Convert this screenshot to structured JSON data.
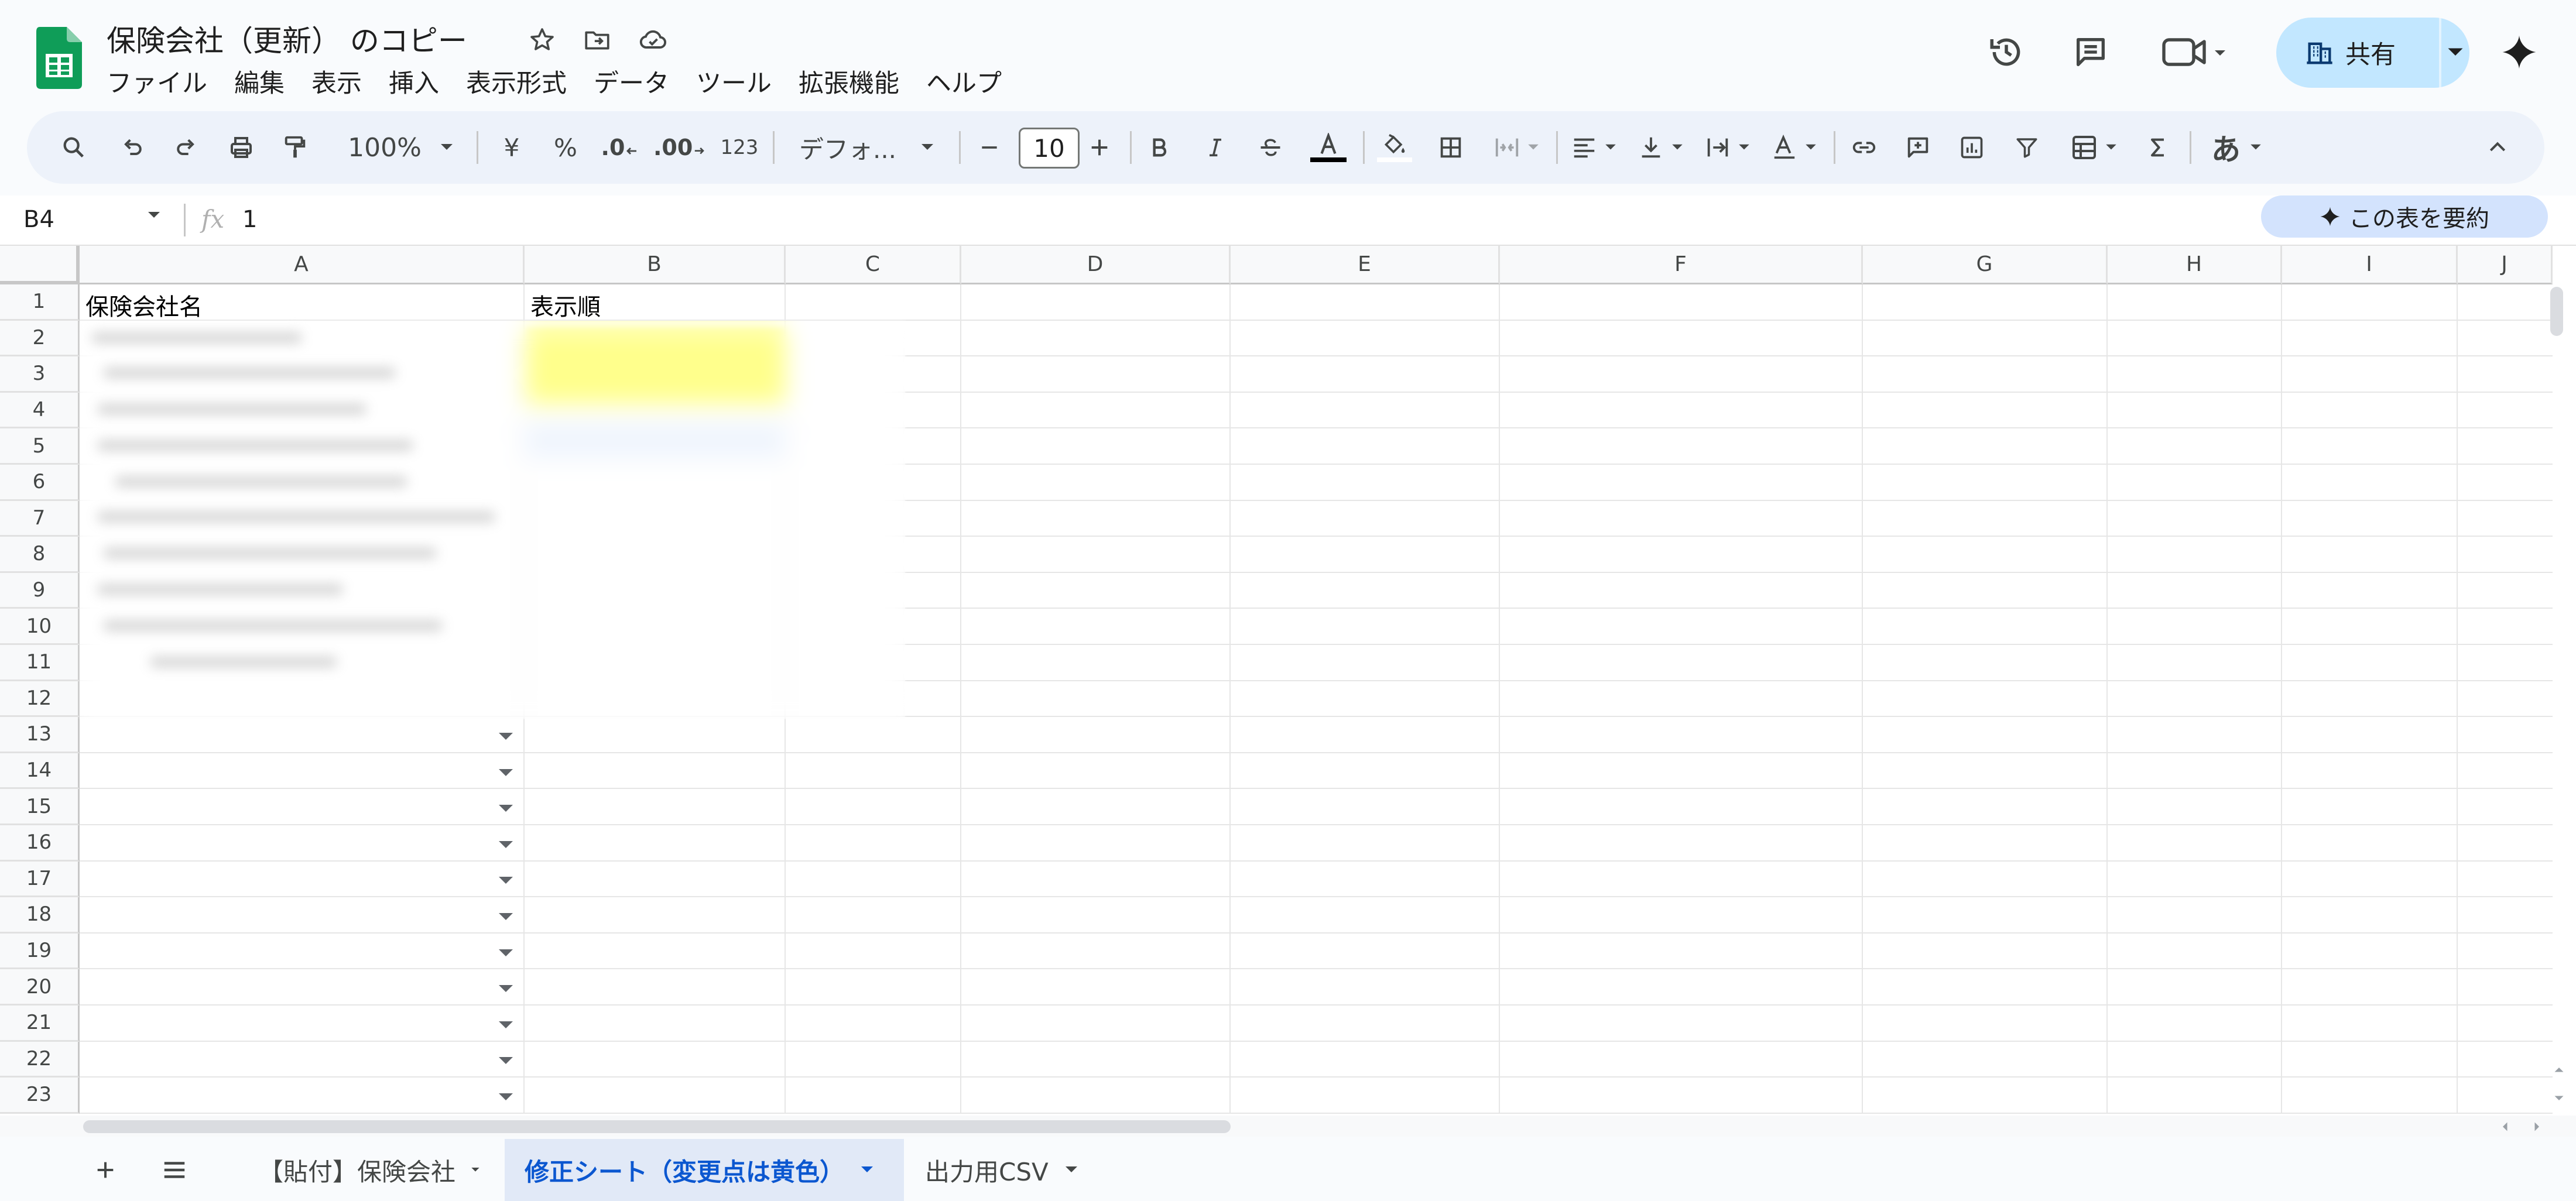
{
  "app": {
    "brand_color": "#0f9d58"
  },
  "document": {
    "title": "保険会社（更新） のコピー"
  },
  "menu": [
    "ファイル",
    "編集",
    "表示",
    "挿入",
    "表示形式",
    "データ",
    "ツール",
    "拡張機能",
    "ヘルプ"
  ],
  "share": {
    "label": "共有",
    "color": "#c2e7ff"
  },
  "toolbar": {
    "zoom": "100%",
    "currency": "¥",
    "percent": "%",
    "dec_decrease": ".0",
    "dec_increase": ".00",
    "number_format": "123",
    "font": "デフォ...",
    "font_size": "10",
    "input_tool": "あ"
  },
  "formula_bar": {
    "cell_ref": "B4",
    "fx": "fx",
    "value": "1",
    "summarize_label": "この表を要約"
  },
  "grid": {
    "columns": [
      "A",
      "B",
      "C",
      "D",
      "E",
      "F",
      "G",
      "H",
      "I",
      "J"
    ],
    "rows": [
      "1",
      "2",
      "3",
      "4",
      "5",
      "6",
      "7",
      "8",
      "9",
      "10",
      "11",
      "12",
      "13",
      "14",
      "15",
      "16",
      "17",
      "18",
      "19",
      "20",
      "21",
      "22",
      "23"
    ],
    "header_a1": "保険会社名",
    "header_b1": "表示順",
    "highlight_color": "#ffff00"
  },
  "sheets": [
    {
      "label": "【貼付】保険会社",
      "active": false
    },
    {
      "label": "修正シート（変更点は黄色）",
      "active": true
    },
    {
      "label": "出力用CSV",
      "active": false
    }
  ]
}
